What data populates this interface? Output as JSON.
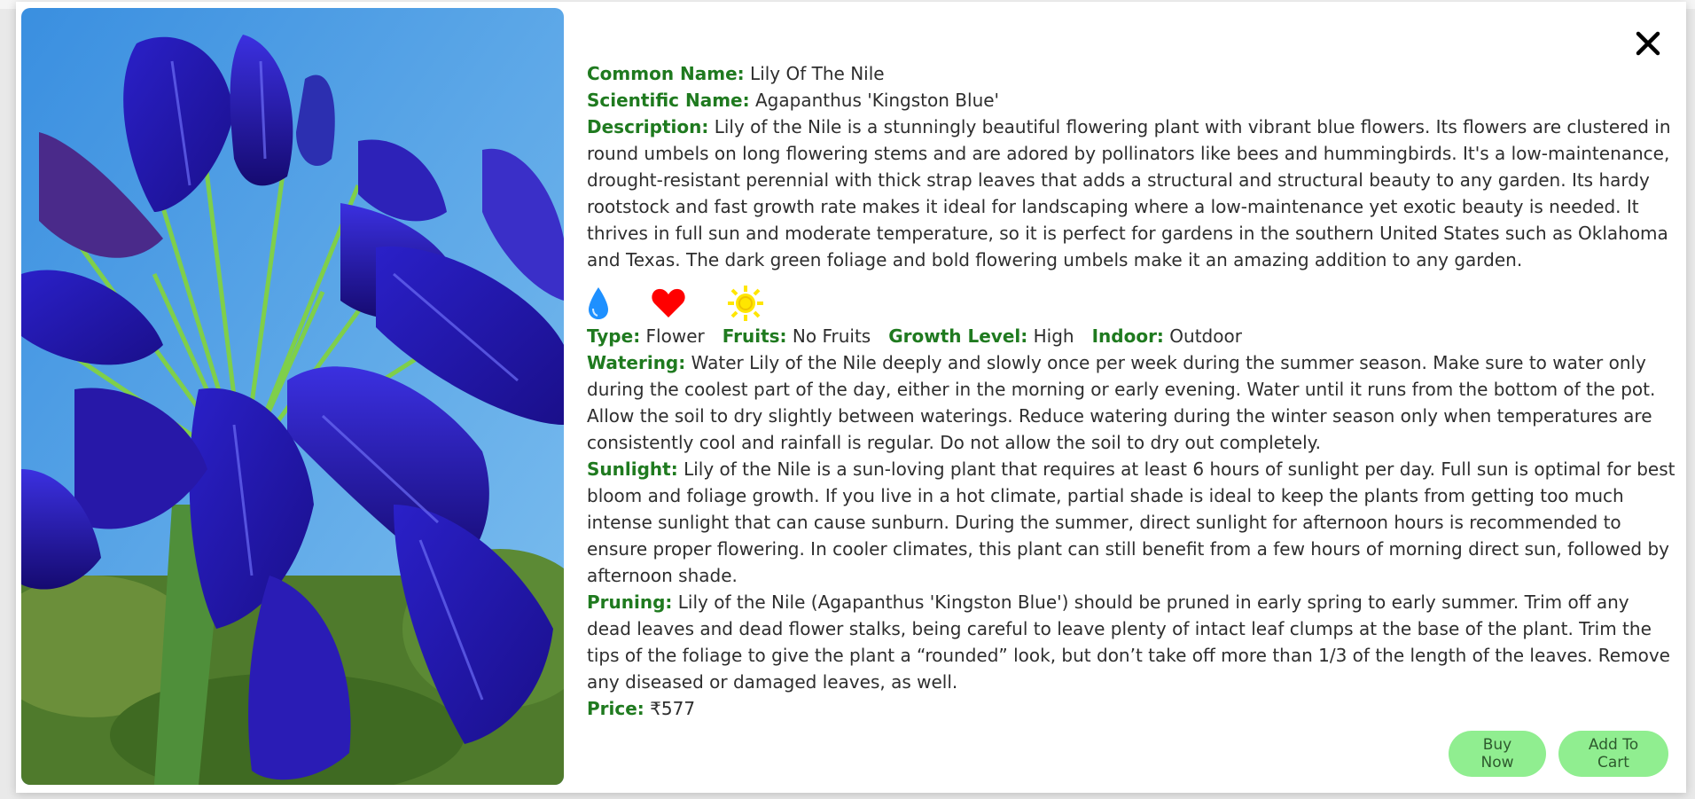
{
  "product": {
    "common_name_label": "Common Name:",
    "common_name": "Lily Of The Nile",
    "scientific_name_label": "Scientific Name:",
    "scientific_name": "Agapanthus 'Kingston Blue'",
    "description_label": "Description:",
    "description": "Lily of the Nile is a stunningly beautiful flowering plant with vibrant blue flowers. Its flowers are clustered in round umbels on long flowering stems and are adored by pollinators like bees and hummingbirds. It's a low-maintenance, drought-resistant perennial with thick strap leaves that adds a structural and structural beauty to any garden. Its hardy rootstock and fast growth rate makes it ideal for landscaping where a low-maintenance yet exotic beauty is needed. It thrives in full sun and moderate temperature, so it is perfect for gardens in the southern United States such as Oklahoma and Texas. The dark green foliage and bold flowering umbels make it an amazing addition to any garden.",
    "icons": [
      "water-drop-icon",
      "heart-icon",
      "sun-icon"
    ],
    "type_label": "Type:",
    "type": "Flower",
    "fruits_label": "Fruits:",
    "fruits": "No Fruits",
    "growth_label": "Growth Level:",
    "growth": "High",
    "indoor_label": "Indoor:",
    "indoor": "Outdoor",
    "watering_label": "Watering:",
    "watering": "Water Lily of the Nile deeply and slowly once per week during the summer season. Make sure to water only during the coolest part of the day, either in the morning or early evening. Water until it runs from the bottom of the pot. Allow the soil to dry slightly between waterings. Reduce watering during the winter season only when temperatures are consistently cool and rainfall is regular. Do not allow the soil to dry out completely.",
    "sunlight_label": "Sunlight:",
    "sunlight": "Lily of the Nile is a sun-loving plant that requires at least 6 hours of sunlight per day. Full sun is optimal for best bloom and foliage growth. If you live in a hot climate, partial shade is ideal to keep the plants from getting too much intense sunlight that can cause sunburn. During the summer, direct sunlight for afternoon hours is recommended to ensure proper flowering. In cooler climates, this plant can still benefit from a few hours of morning direct sun, followed by afternoon shade.",
    "pruning_label": "Pruning:",
    "pruning": "Lily of the Nile (Agapanthus 'Kingston Blue') should be pruned in early spring to early summer. Trim off any dead leaves and dead flower stalks, being careful to leave plenty of intact leaf clumps at the base of the plant. Trim the tips of the foliage to give the plant a “rounded” look, but don’t take off more than 1/3 of the length of the leaves. Remove any diseased or damaged leaves, as well.",
    "price_label": "Price:",
    "price": "₹577"
  },
  "actions": {
    "buy_now": "Buy Now",
    "add_to_cart": "Add To Cart"
  },
  "colors": {
    "label_green": "#1f7a1f",
    "button_green": "#90ee90",
    "drop_blue": "#1e90ff",
    "heart_red": "#ff0000",
    "sun_yellow": "#ffe600"
  }
}
